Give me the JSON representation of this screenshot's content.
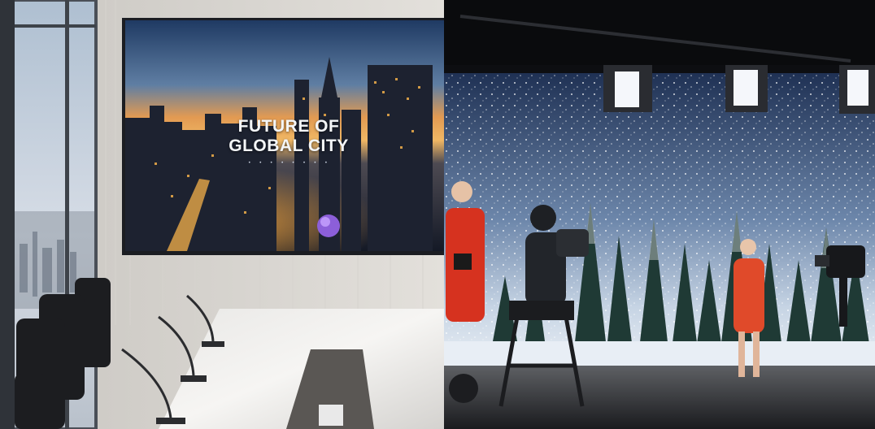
{
  "scenes": {
    "conference_room": {
      "screen_title_line1": "FUTURE OF",
      "screen_title_line2": "GLOBAL CITY"
    }
  }
}
